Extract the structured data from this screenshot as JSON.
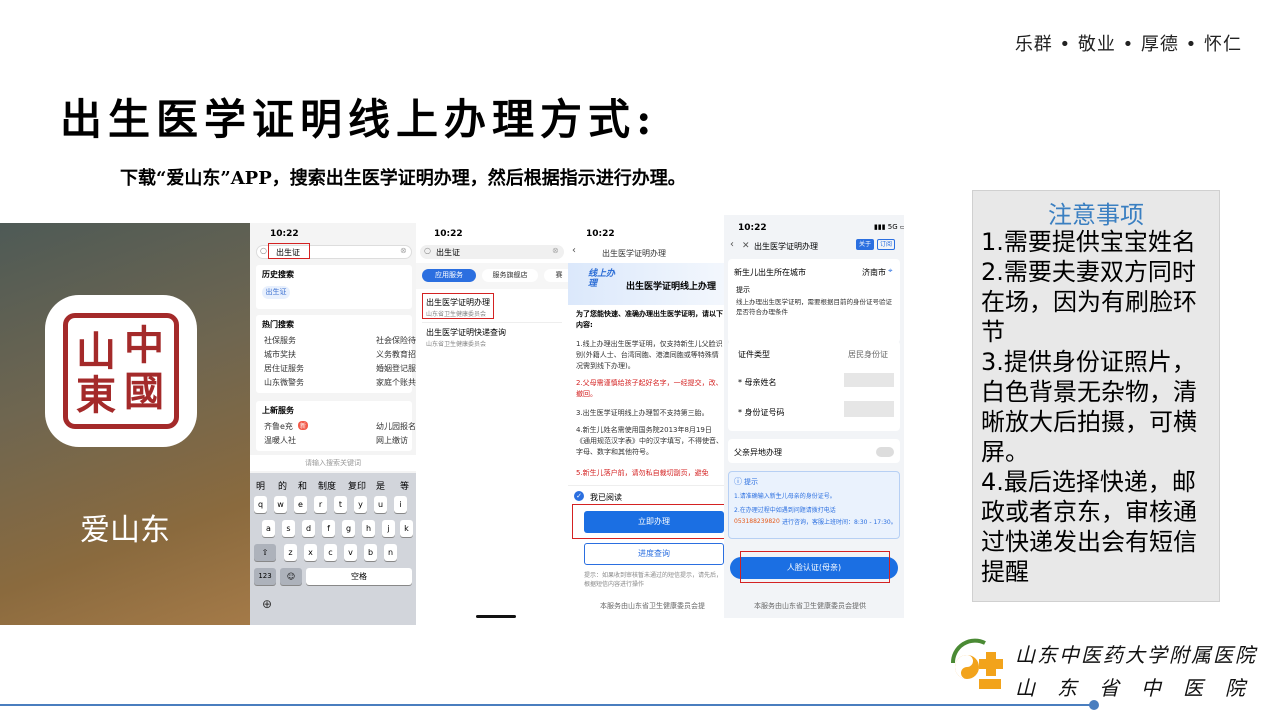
{
  "slide": {
    "motto": "乐群 • 敬业 • 厚德 • 怀仁",
    "title": "出生医学证明线上办理方式:",
    "subtitle": "下载“爱山东”APP，搜索出生医学证明办理，然后根据指示进行办理。"
  },
  "app_icon": {
    "name": "爱山东",
    "seal_chars": [
      "山",
      "中",
      "東",
      "國"
    ]
  },
  "screen1": {
    "time": "10:22",
    "search_value": "出生证",
    "history_title": "历史搜索",
    "history_tag": "出生证",
    "hot_title": "热门搜索",
    "hot_items": [
      [
        "社保服务",
        "社会保险待遇"
      ],
      [
        "城市奖扶",
        "义务教育招生"
      ],
      [
        "居住证服务",
        "婚姻登记服务"
      ],
      [
        "山东微警务",
        "家庭个账共济"
      ]
    ],
    "new_title": "上新服务",
    "new_items": [
      [
        "齐鲁e充",
        "幼儿园报名"
      ],
      [
        "温暖人社",
        "网上缴访"
      ]
    ],
    "kb_hint": "请输入搜索关键词",
    "kb_suggest": [
      "明",
      "的",
      "和",
      "制度",
      "复印",
      "是",
      "等"
    ],
    "kb_row1": [
      "q",
      "w",
      "e",
      "r",
      "t",
      "y",
      "u",
      "i"
    ],
    "kb_row2": [
      "a",
      "s",
      "d",
      "f",
      "g",
      "h",
      "j",
      "k"
    ],
    "kb_row3": [
      "z",
      "x",
      "c",
      "v",
      "b",
      "n"
    ],
    "kb_num": "123",
    "kb_space": "空格"
  },
  "screen2": {
    "time": "10:22",
    "search_value": "出生证",
    "tabs": [
      "应用服务",
      "服务旗舰店",
      "赛"
    ],
    "result1_title": "出生医学证明办理",
    "result1_dept": "山东省卫生健康委员会",
    "result2_title": "出生医学证明快递查询",
    "result2_dept": "山东省卫生健康委员会"
  },
  "screen3": {
    "time": "10:22",
    "nav_title": "出生医学证明办理",
    "banner_tag": "线上办理",
    "banner_title": "出生医学证明线上办理",
    "intro": "为了您能快速、准确办理出生医学证明，请以下内容:",
    "p1": "1.线上办理出生医学证明，仅支持新生儿父脸识别(外籍人士、台湾同胞、港澳同胞或等特殊情况需到线下办理)。",
    "p2": "2.父母需谨慎给孩子起好名字，一经提交，改、撤回。",
    "p3": "3.出生医学证明线上办理暂不支持第三胎。",
    "p4": "4.新生儿姓名需使用国务院2013年8月19日《通用规范汉字表》中的汉字填写，不得使音、字母、数字和其他符号。",
    "p5": "5.新生儿落户前，请勿私自裁切副页，避免",
    "agree": "我已阅读",
    "btn_apply": "立即办理",
    "btn_query": "进度查询",
    "tip": "提示：如果收到审核暂未通过的短信提示，请先后，根据短信内容进行操作",
    "footer": "本服务由山东省卫生健康委员会提"
  },
  "screen4": {
    "time": "10:22",
    "nav_title": "出生医学证明办理",
    "nav_btn1": "关于",
    "nav_btn2": "订阅",
    "city_label": "新生儿出生所在城市",
    "city_value": "济南市",
    "tip_title": "提示",
    "tip_text": "线上办理出生医学证明，需要根据目前的身份证号验证是否符合办理条件",
    "id_type_label": "证件类型",
    "id_type_value": "居民身份证",
    "mother_name_label": "* 母亲姓名",
    "id_no_label": "* 身份证号码",
    "father_label": "父亲异地办理",
    "notice_title": "提示",
    "notice_1": "1.请准确输入新生儿母亲的身份证号。",
    "notice_2": "2.在办理过程中如遇到问题请拨打电话",
    "phone": "053188239820",
    "notice_3": "进行咨询，客服上班时间：8:30 - 17:30。",
    "btn_face": "人脸认证(母亲)",
    "footer": "本服务由山东省卫生健康委员会提供"
  },
  "notes": {
    "title": "注意事项",
    "lines": [
      "1.需要提供宝宝姓名",
      "2.需要夫妻双方同时在场，因为有刷脸环节",
      "3.提供身份证照片，白色背景无杂物，清晰放大后拍摄，可横屏。",
      "4.最后选择快递，邮政或者京东，审核通过快递发出会有短信提醒"
    ]
  },
  "hospital": {
    "line1": "山东中医药大学附属医院",
    "line2": "山东省中医院"
  },
  "colors": {
    "accent_blue": "#1b6fe3",
    "highlight_red": "#d42222",
    "notes_title": "#3a7fc1",
    "rule_blue": "#4a7ebf"
  }
}
